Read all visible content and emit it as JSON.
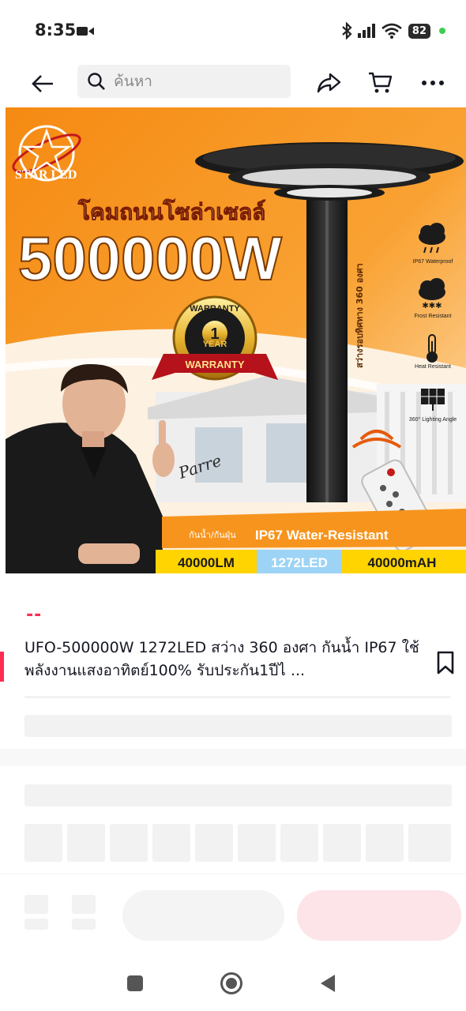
{
  "status_bar": {
    "time": "8:35",
    "battery": "82",
    "icons": [
      "video-camera-icon",
      "bluetooth-icon",
      "signal-icon",
      "wifi-icon",
      "battery-icon"
    ]
  },
  "top_nav": {
    "search_placeholder": "ค้นหา",
    "icons": [
      "back-arrow-icon",
      "search-icon",
      "share-icon",
      "cart-icon",
      "more-icon"
    ]
  },
  "product_image": {
    "brand": "STAR LED",
    "headline_thai": "โคมถนนโซล่าเซลล์",
    "headline_power": "500000W",
    "warranty_top": "WARRANTY",
    "warranty_years": "1",
    "warranty_year_label": "YEAR",
    "warranty_ribbon": "WARRANTY",
    "vertical_text": "สว่างรอบทิศทาง 360 องศา",
    "features": [
      {
        "icon": "rain-cloud-icon",
        "label": "IP67 Waterproof"
      },
      {
        "icon": "snow-cloud-icon",
        "label": "Frost Resistant"
      },
      {
        "icon": "thermometer-icon",
        "label": "Heat Resistant"
      },
      {
        "icon": "solar-panel-icon",
        "label": "360° Lighting Angle"
      }
    ],
    "water_label_thai": "กันน้ำ/กันฝุ่น",
    "water_label": "IP67 Water-Resistant",
    "spec_lumen": "40000LM",
    "spec_led": "1272LED",
    "spec_battery": "40000mAH",
    "signature": "Parre"
  },
  "price_placeholder": "--",
  "product_title": "UFO-500000W 1272LED สว่าง 360 องศา กันน้ำ IP67 ใช้พลังงานแสงอาทิตย์100% รับประกัน1ปีไ ...",
  "colors": {
    "accent": "#fe2c55",
    "banner_orange": "#f7941d",
    "spec_yellow": "#ffd400",
    "skeleton": "#f2f2f2"
  }
}
